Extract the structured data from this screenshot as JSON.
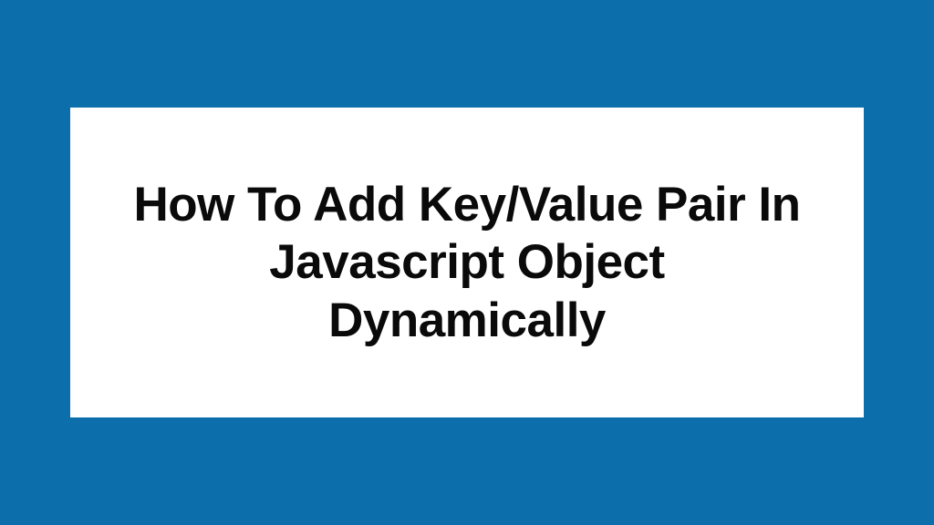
{
  "card": {
    "title": "How To Add Key/Value Pair In Javascript Object Dynamically"
  },
  "colors": {
    "background": "#0c6eab",
    "card": "#ffffff",
    "text": "#0a0a0a"
  }
}
